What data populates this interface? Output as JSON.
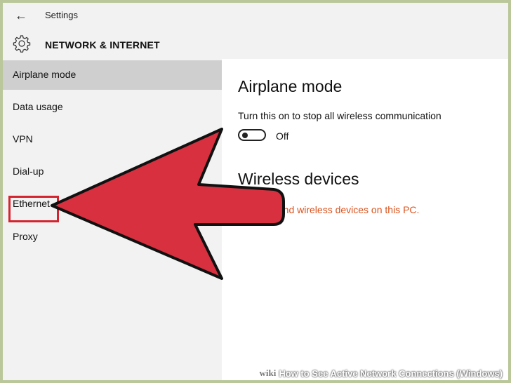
{
  "window": {
    "back_icon": "arrow-left-icon",
    "title": "Settings"
  },
  "header": {
    "icon": "gear-icon",
    "title": "NETWORK & INTERNET"
  },
  "sidebar": {
    "items": [
      {
        "label": "Airplane mode",
        "active": true
      },
      {
        "label": "Data usage",
        "active": false
      },
      {
        "label": "VPN",
        "active": false
      },
      {
        "label": "Dial-up",
        "active": false
      },
      {
        "label": "Ethernet",
        "active": false,
        "highlighted": true
      },
      {
        "label": "Proxy",
        "active": false
      }
    ]
  },
  "main": {
    "airplane_heading": "Airplane mode",
    "airplane_description": "Turn this on to stop all wireless communication",
    "toggle_state": "Off",
    "wireless_heading": "Wireless devices",
    "wireless_message": "We can't find wireless devices on this PC."
  },
  "overlay": {
    "arrow_color": "#d8303f",
    "highlight_color": "#d3242f",
    "caption_wiki": "wiki",
    "caption_text": "How to See Active Network Connections (Windows)"
  },
  "colors": {
    "accent_link": "#d9531e",
    "sidebar_active": "#cfcfcf"
  }
}
